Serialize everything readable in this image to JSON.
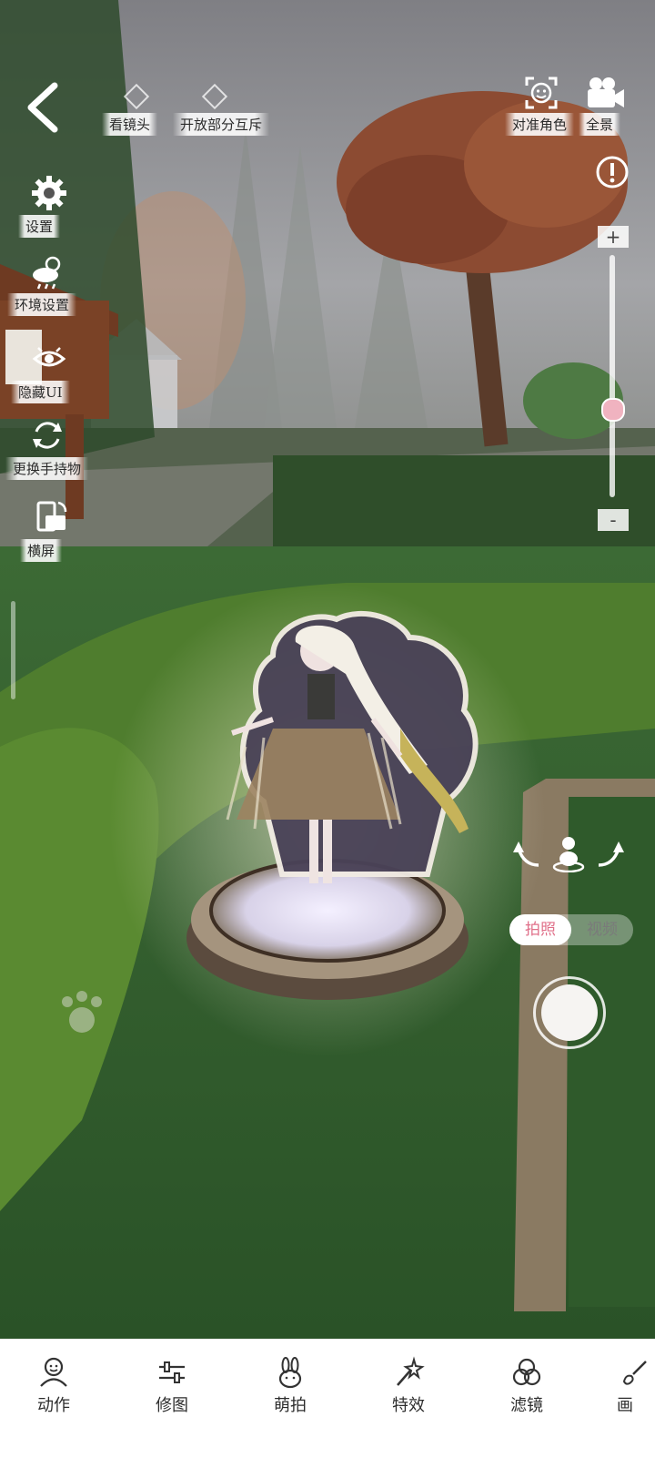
{
  "top_bar": {
    "look_at_camera": "看镜头",
    "partial_interaction": "开放部分互斥",
    "focus_character": "对准角色",
    "panorama": "全景"
  },
  "left_menu": [
    {
      "label": "设置",
      "icon": "gear-icon"
    },
    {
      "label": "环境设置",
      "icon": "weather-icon"
    },
    {
      "label": "隐藏UI",
      "icon": "eye-icon"
    },
    {
      "label": "更换手持物",
      "icon": "swap-icon"
    },
    {
      "label": "横屏",
      "icon": "rotate-screen-icon"
    }
  ],
  "zoom": {
    "plus": "+",
    "minus": "-",
    "level": 0.45
  },
  "mode_toggle": {
    "photo": "拍照",
    "video": "视频",
    "selected": "photo"
  },
  "bottom_tabs": [
    {
      "label": "动作",
      "icon": "pose-icon"
    },
    {
      "label": "修图",
      "icon": "adjust-icon"
    },
    {
      "label": "萌拍",
      "icon": "bunny-icon"
    },
    {
      "label": "特效",
      "icon": "wand-icon"
    },
    {
      "label": "滤镜",
      "icon": "filter-icon"
    },
    {
      "label": "画",
      "icon": "brush-icon"
    }
  ],
  "colors": {
    "accent": "#e0708a",
    "panel": "#ffffff",
    "text": "#2d2d2d"
  }
}
